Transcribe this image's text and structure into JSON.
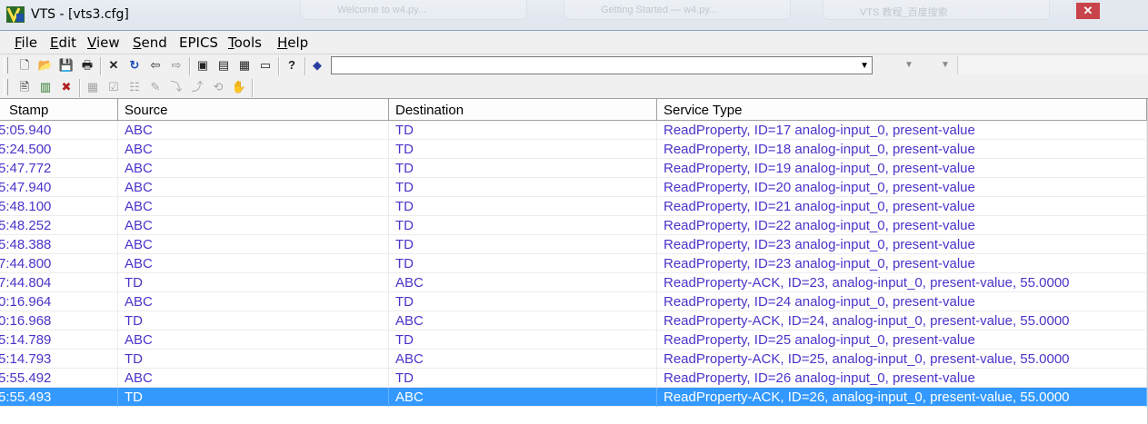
{
  "window": {
    "title": "VTS - [vts3.cfg]",
    "app_icon": "vts-app-icon",
    "background_tabs": [
      "Welcome to w4.py...",
      "Getting Started — w4.py...",
      "VTS 教程_百度搜索"
    ],
    "close_glyph": "✕"
  },
  "menu": {
    "items": [
      {
        "label": "File",
        "key": "F",
        "rest": "ile"
      },
      {
        "label": "Edit",
        "key": "E",
        "rest": "dit"
      },
      {
        "label": "View",
        "key": "V",
        "rest": "iew"
      },
      {
        "label": "Send",
        "key": "S",
        "rest": "end"
      },
      {
        "label": "EPICS",
        "key": "",
        "rest": "EPICS"
      },
      {
        "label": "Tools",
        "key": "T",
        "rest": "ools"
      },
      {
        "label": "Help",
        "key": "H",
        "rest": "elp"
      }
    ]
  },
  "toolbar": {
    "buttons": [
      {
        "name": "new-file-icon",
        "glyph": "🗋"
      },
      {
        "name": "open-folder-icon",
        "glyph": "📂"
      },
      {
        "name": "save-icon",
        "glyph": "💾"
      },
      {
        "name": "print-icon",
        "glyph": "🖶"
      },
      {
        "name": "delete-icon",
        "glyph": "✕"
      },
      {
        "name": "refresh-icon",
        "glyph": "↻"
      },
      {
        "name": "back-arrow-icon",
        "glyph": "⇦"
      },
      {
        "name": "forward-arrow-icon",
        "glyph": "⇨"
      },
      {
        "name": "port-window-icon",
        "glyph": "▣"
      },
      {
        "name": "names-window-icon",
        "glyph": "▤"
      },
      {
        "name": "devices-window-icon",
        "glyph": "▦"
      },
      {
        "name": "script-window-icon",
        "glyph": "▭"
      },
      {
        "name": "help-question-icon",
        "glyph": "?"
      },
      {
        "name": "bookmark-icon",
        "glyph": "◆"
      }
    ],
    "combo_value": "",
    "combo_arrow": "▼",
    "combo2_arrow": "▼",
    "secondary_buttons": [
      {
        "name": "document-icon",
        "glyph": "🖹",
        "disabled": false
      },
      {
        "name": "book-icon",
        "glyph": "▥",
        "disabled": false
      },
      {
        "name": "stop-script-icon",
        "glyph": "✖",
        "disabled": false
      },
      {
        "name": "calendar-icon",
        "glyph": "▦",
        "disabled": true
      },
      {
        "name": "check-doc-icon",
        "glyph": "☑",
        "disabled": true
      },
      {
        "name": "step-doc-icon",
        "glyph": "☷",
        "disabled": true
      },
      {
        "name": "edit-doc-icon",
        "glyph": "✎",
        "disabled": true
      },
      {
        "name": "step-into-icon",
        "glyph": "⤵",
        "disabled": true
      },
      {
        "name": "step-over-icon",
        "glyph": "⤴",
        "disabled": true
      },
      {
        "name": "step-out-icon",
        "glyph": "⟲",
        "disabled": true
      },
      {
        "name": "hand-icon",
        "glyph": "✋",
        "disabled": true
      }
    ]
  },
  "table": {
    "columns": [
      "Stamp",
      "Source",
      "Destination",
      "Service Type"
    ],
    "rows": [
      [
        "5:05.940",
        "ABC",
        "TD",
        "ReadProperty, ID=17 analog-input_0, present-value"
      ],
      [
        "5:24.500",
        "ABC",
        "TD",
        "ReadProperty, ID=18 analog-input_0, present-value"
      ],
      [
        "5:47.772",
        "ABC",
        "TD",
        "ReadProperty, ID=19 analog-input_0, present-value"
      ],
      [
        "5:47.940",
        "ABC",
        "TD",
        "ReadProperty, ID=20 analog-input_0, present-value"
      ],
      [
        "5:48.100",
        "ABC",
        "TD",
        "ReadProperty, ID=21 analog-input_0, present-value"
      ],
      [
        "5:48.252",
        "ABC",
        "TD",
        "ReadProperty, ID=22 analog-input_0, present-value"
      ],
      [
        "5:48.388",
        "ABC",
        "TD",
        "ReadProperty, ID=23 analog-input_0, present-value"
      ],
      [
        "7:44.800",
        "ABC",
        "TD",
        "ReadProperty, ID=23 analog-input_0, present-value"
      ],
      [
        "7:44.804",
        "TD",
        "ABC",
        "ReadProperty-ACK, ID=23, analog-input_0, present-value,  55.0000"
      ],
      [
        "0:16.964",
        "ABC",
        "TD",
        "ReadProperty, ID=24 analog-input_0, present-value"
      ],
      [
        "0:16.968",
        "TD",
        "ABC",
        "ReadProperty-ACK, ID=24, analog-input_0, present-value,  55.0000"
      ],
      [
        "5:14.789",
        "ABC",
        "TD",
        "ReadProperty, ID=25 analog-input_0, present-value"
      ],
      [
        "5:14.793",
        "TD",
        "ABC",
        "ReadProperty-ACK, ID=25, analog-input_0, present-value,  55.0000"
      ],
      [
        "5:55.492",
        "ABC",
        "TD",
        "ReadProperty, ID=26 analog-input_0, present-value"
      ],
      [
        "5:55.493",
        "TD",
        "ABC",
        "ReadProperty-ACK, ID=26, analog-input_0, present-value,  55.0000"
      ]
    ],
    "selected_row": 14
  },
  "colors": {
    "row_text": "#4b33c9",
    "selection": "#3399ff"
  }
}
